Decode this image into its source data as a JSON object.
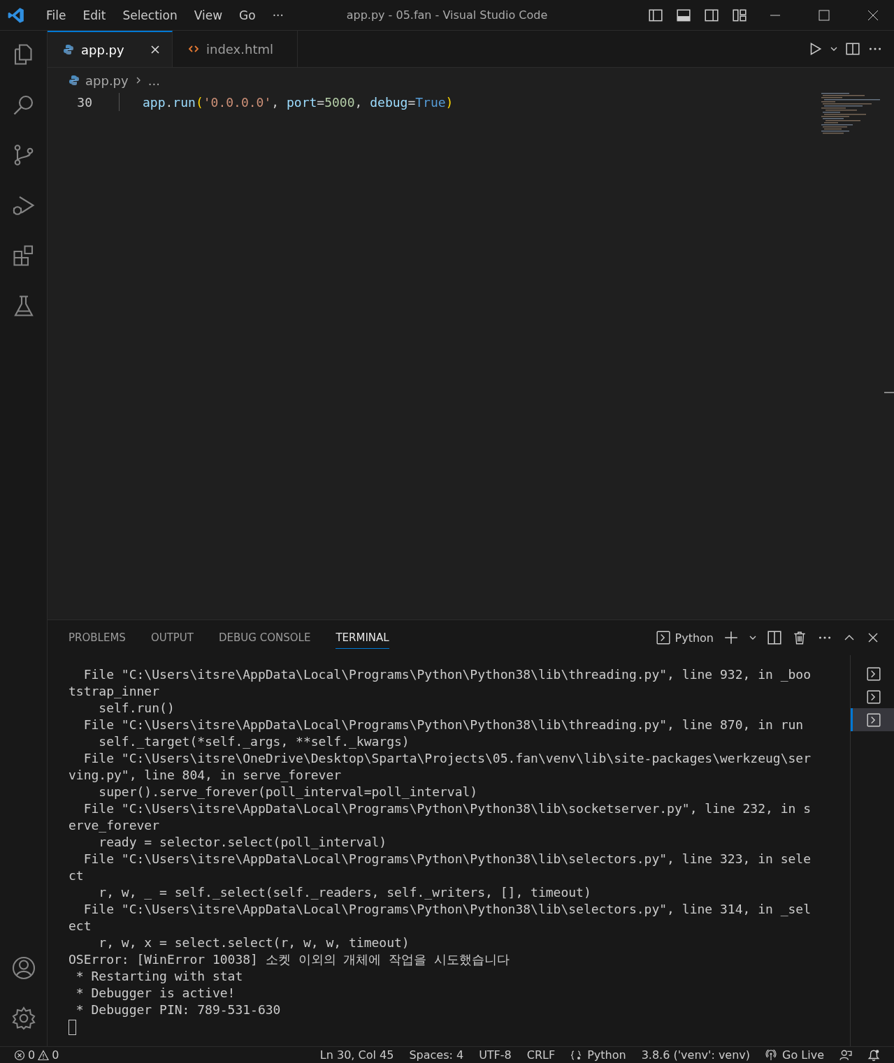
{
  "title_bar": {
    "menu": [
      "File",
      "Edit",
      "Selection",
      "View",
      "Go",
      "···"
    ],
    "title": "app.py - 05.fan - Visual Studio Code"
  },
  "tabs": [
    {
      "label": "app.py",
      "kind": "python",
      "selected": true
    },
    {
      "label": "index.html",
      "kind": "html",
      "selected": false
    }
  ],
  "breadcrumb": {
    "file": "app.py",
    "rest": "..."
  },
  "editor": {
    "lines": [
      {
        "number": "30",
        "tokens": [
          {
            "kind": "variable",
            "text": "app"
          },
          {
            "kind": "plain",
            "text": "."
          },
          {
            "kind": "variable",
            "text": "run"
          },
          {
            "kind": "bracket",
            "text": "("
          },
          {
            "kind": "string",
            "text": "'0.0.0.0'"
          },
          {
            "kind": "plain",
            "text": ", "
          },
          {
            "kind": "variable",
            "text": "port"
          },
          {
            "kind": "plain",
            "text": "="
          },
          {
            "kind": "number",
            "text": "5000"
          },
          {
            "kind": "plain",
            "text": ", "
          },
          {
            "kind": "variable",
            "text": "debug"
          },
          {
            "kind": "plain",
            "text": "="
          },
          {
            "kind": "constant",
            "text": "True"
          },
          {
            "kind": "bracket",
            "text": ")"
          }
        ]
      }
    ]
  },
  "panel": {
    "tabs": [
      {
        "label": "PROBLEMS",
        "selected": false
      },
      {
        "label": "OUTPUT",
        "selected": false
      },
      {
        "label": "DEBUG CONSOLE",
        "selected": false
      },
      {
        "label": "TERMINAL",
        "selected": true
      }
    ],
    "profile": "Python",
    "terminal_lines": [
      "  File \"C:\\Users\\itsre\\AppData\\Local\\Programs\\Python\\Python38\\lib\\threading.py\", line 932, in _boo",
      "tstrap_inner",
      "    self.run()",
      "  File \"C:\\Users\\itsre\\AppData\\Local\\Programs\\Python\\Python38\\lib\\threading.py\", line 870, in run",
      "    self._target(*self._args, **self._kwargs)",
      "  File \"C:\\Users\\itsre\\OneDrive\\Desktop\\Sparta\\Projects\\05.fan\\venv\\lib\\site-packages\\werkzeug\\ser",
      "ving.py\", line 804, in serve_forever",
      "    super().serve_forever(poll_interval=poll_interval)",
      "  File \"C:\\Users\\itsre\\AppData\\Local\\Programs\\Python\\Python38\\lib\\socketserver.py\", line 232, in s",
      "erve_forever",
      "    ready = selector.select(poll_interval)",
      "  File \"C:\\Users\\itsre\\AppData\\Local\\Programs\\Python\\Python38\\lib\\selectors.py\", line 323, in sele",
      "ct",
      "    r, w, _ = self._select(self._readers, self._writers, [], timeout)",
      "  File \"C:\\Users\\itsre\\AppData\\Local\\Programs\\Python\\Python38\\lib\\selectors.py\", line 314, in _sel",
      "ect",
      "    r, w, x = select.select(r, w, w, timeout)",
      "OSError: [WinError 10038] 소켓 이외의 개체에 작업을 시도했습니다",
      " * Restarting with stat",
      " * Debugger is active!",
      " * Debugger PIN: 789-531-630"
    ],
    "terminals": [
      {
        "selected": false
      },
      {
        "selected": false
      },
      {
        "selected": true
      }
    ]
  },
  "status_bar": {
    "errors": "0",
    "warnings": "0",
    "items": [
      {
        "kind": "text",
        "label": "Ln 30, Col 45"
      },
      {
        "kind": "text",
        "label": "Spaces: 4"
      },
      {
        "kind": "text",
        "label": "UTF-8"
      },
      {
        "kind": "text",
        "label": "CRLF"
      },
      {
        "kind": "language",
        "label": "Python"
      },
      {
        "kind": "text",
        "label": "3.8.6 ('venv': venv)"
      },
      {
        "kind": "golive",
        "label": "Go Live"
      },
      {
        "kind": "feedback"
      },
      {
        "kind": "bell"
      }
    ]
  }
}
